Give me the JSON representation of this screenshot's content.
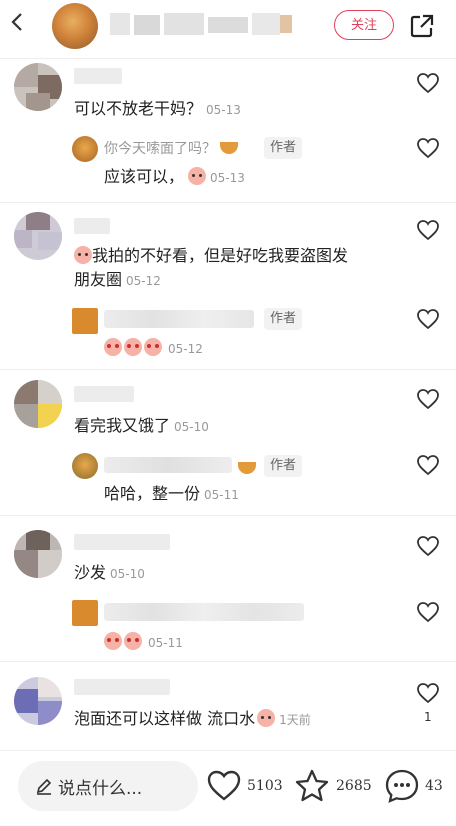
{
  "header": {
    "follow_label": "关注"
  },
  "comments": [
    {
      "text": "可以不放老干妈？",
      "date": "05-13"
    },
    {
      "reply_to": "你今天嗦面了吗？",
      "author_badge": "作者",
      "text": "应该可以，",
      "date": "05-13"
    },
    {
      "text_line1": "我拍的不好看，但是好吃我要盗图发",
      "text_line2": "朋友圈",
      "date": "05-12"
    },
    {
      "author_badge": "作者",
      "date": "05-12"
    },
    {
      "text": "看完我又饿了",
      "date": "05-10"
    },
    {
      "author_badge": "作者",
      "text": "哈哈，整一份",
      "date": "05-11"
    },
    {
      "text": "沙发",
      "date": "05-10"
    },
    {
      "date": "05-11"
    },
    {
      "text": "泡面还可以这样做 流口水",
      "date": "1天前",
      "likes": "1"
    }
  ],
  "bottom_bar": {
    "input_placeholder": "说点什么...",
    "like_count": "5103",
    "star_count": "2685",
    "comment_count": "43"
  },
  "colors": {
    "accent": "#e0415a",
    "secondary_text": "#999999"
  }
}
